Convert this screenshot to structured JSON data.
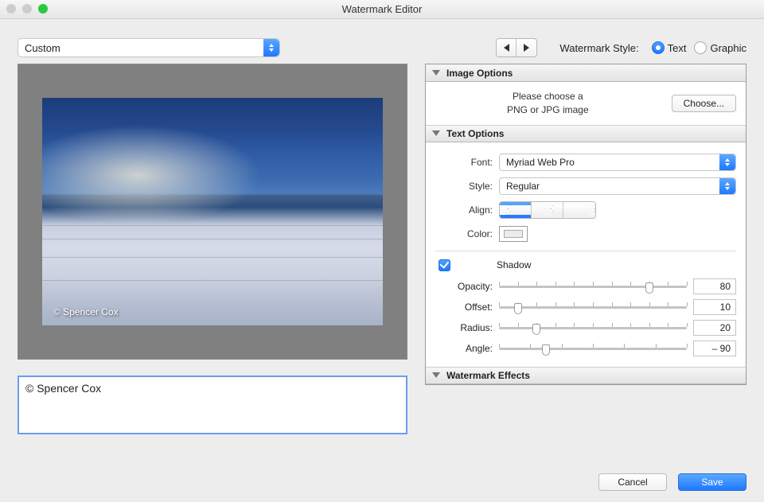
{
  "window": {
    "title": "Watermark Editor"
  },
  "preset": {
    "value": "Custom"
  },
  "style": {
    "label": "Watermark Style:",
    "text_label": "Text",
    "graphic_label": "Graphic",
    "selected": "text"
  },
  "panels": {
    "image_options": {
      "title": "Image Options",
      "hint_line1": "Please choose a",
      "hint_line2": "PNG or JPG image",
      "choose_label": "Choose..."
    },
    "text_options": {
      "title": "Text Options",
      "font_label": "Font:",
      "font_value": "Myriad Web Pro",
      "style_label": "Style:",
      "style_value": "Regular",
      "align_label": "Align:",
      "align_value": "left",
      "color_label": "Color:",
      "color_value": "#ECECEC",
      "shadow": {
        "enabled": true,
        "label": "Shadow",
        "opacity_label": "Opacity:",
        "opacity": 80,
        "offset_label": "Offset:",
        "offset": 10,
        "radius_label": "Radius:",
        "radius": 20,
        "angle_label": "Angle:",
        "angle": "– 90"
      }
    },
    "watermark_effects": {
      "title": "Watermark Effects"
    }
  },
  "preview": {
    "watermark_text": "© Spencer Cox"
  },
  "text_field": {
    "value": "© Spencer Cox"
  },
  "footer": {
    "cancel": "Cancel",
    "save": "Save"
  }
}
